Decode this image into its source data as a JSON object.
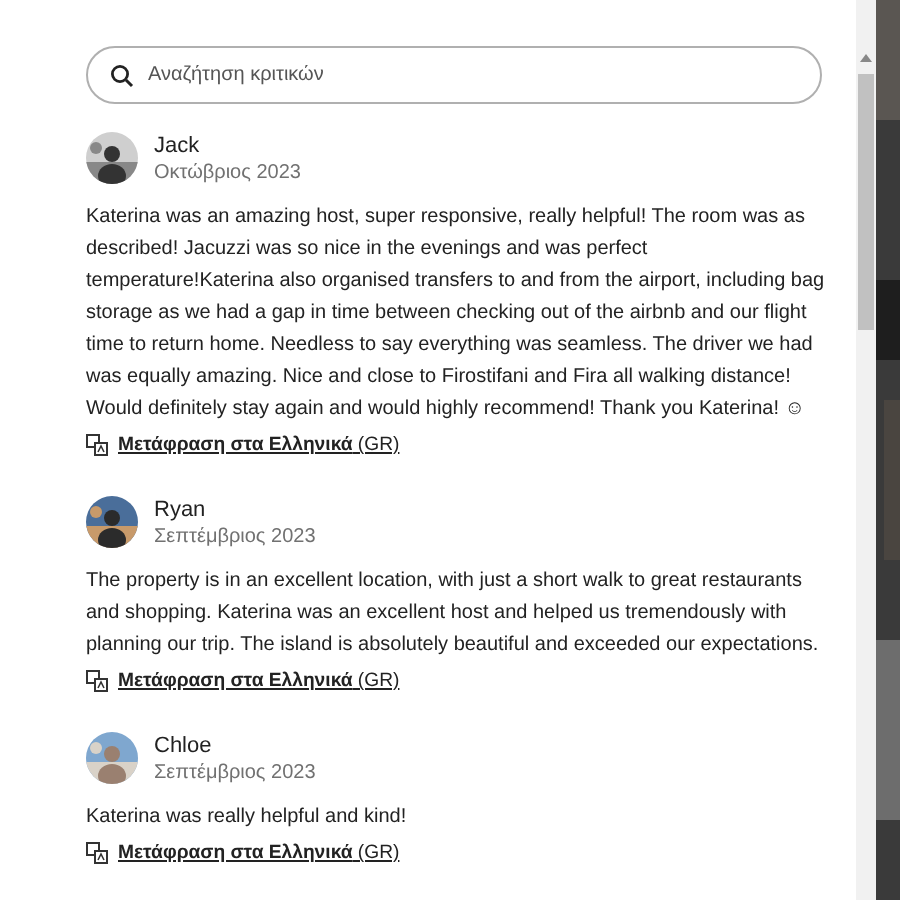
{
  "search": {
    "placeholder": "Αναζήτηση κριτικών"
  },
  "reviews": [
    {
      "name": "Jack",
      "date": "Οκτώβριος 2023",
      "text": "Katerina was an amazing host, super responsive, really helpful! The room was as described! Jacuzzi was so nice in the evenings and was perfect temperature!Katerina also organised transfers to and from the airport, including bag storage as we had a gap in time between checking out of the airbnb and our flight time to return home. Needless to say everything was seamless. The driver we had was equally amazing. Nice and close to Firostifani and Fira all walking distance! Would definitely stay again and would highly recommend! Thank you Katerina! ☺",
      "translate": "**Μετάφραση στα Ελληνικά** (GR)"
    },
    {
      "name": "Ryan",
      "date": "Σεπτέμβριος 2023",
      "text": "The property is in an excellent location, with just a short walk to great restaurants and shopping. Katerina was an excellent host and helped us tremendously with planning our trip. The island is absolutely beautiful and exceeded our expectations.",
      "translate": "**Μετάφραση στα Ελληνικά** (GR)"
    },
    {
      "name": "Chloe",
      "date": "Σεπτέμβριος 2023",
      "text": "Katerina was really helpful and kind!",
      "translate": "**Μετάφραση στα Ελληνικά** (GR)"
    }
  ]
}
